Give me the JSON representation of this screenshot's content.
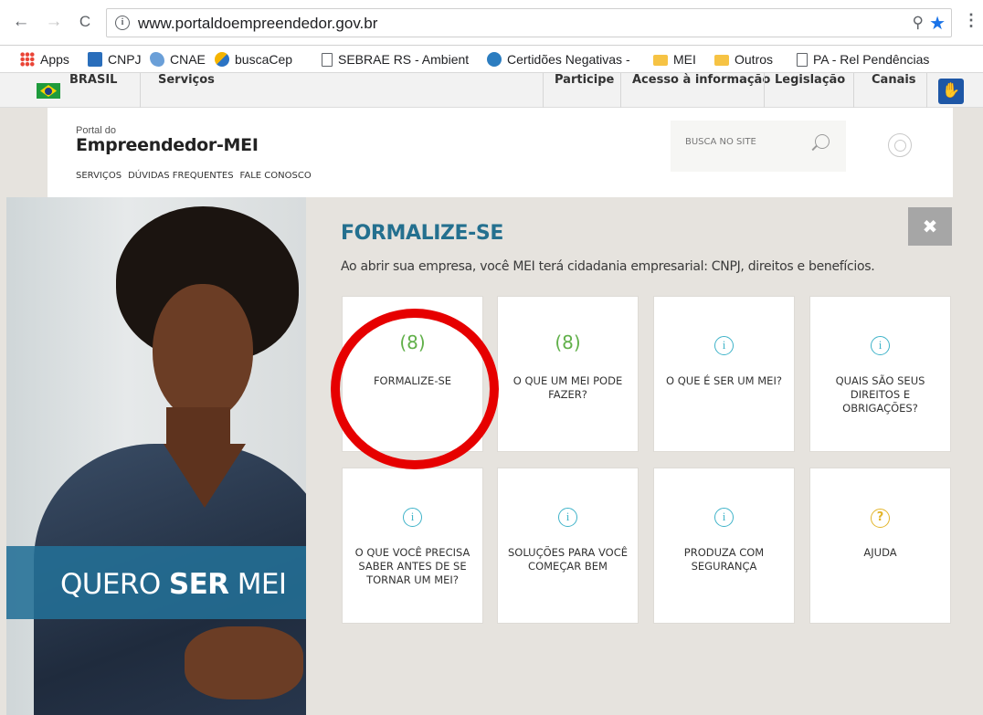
{
  "browser": {
    "url": "www.portaldoempreendedor.gov.br",
    "nav": {
      "back": "←",
      "forward": "→",
      "reload": "C"
    },
    "bookmarks": [
      {
        "label": "Apps",
        "icon": "apps-grid-icon"
      },
      {
        "label": "CNPJ",
        "icon": "cnpj-favicon"
      },
      {
        "label": "CNAE",
        "icon": "cnae-favicon"
      },
      {
        "label": "buscaCep",
        "icon": "buscacep-favicon"
      },
      {
        "label": "SEBRAE RS - Ambient",
        "icon": "page-icon"
      },
      {
        "label": "Certidões Negativas -",
        "icon": "certidoes-favicon"
      },
      {
        "label": "MEI",
        "icon": "folder-icon"
      },
      {
        "label": "Outros",
        "icon": "folder-icon"
      },
      {
        "label": "PA - Rel Pendências",
        "icon": "page-icon"
      }
    ]
  },
  "gov_bar": {
    "brasil": "BRASIL",
    "servicos": "Serviços",
    "links": [
      "Participe",
      "Acesso à informação",
      "Legislação",
      "Canais"
    ]
  },
  "portal": {
    "small_title": "Portal do",
    "title": "Empreendedor-MEI",
    "nav": [
      "SERVIÇOS",
      "DÚVIDAS FREQUENTES",
      "FALE CONOSCO"
    ],
    "search_placeholder": "BUSCA NO SITE"
  },
  "hero": {
    "banner_prefix": "QUERO ",
    "banner_bold": "SER",
    "banner_suffix": " MEI"
  },
  "section": {
    "title": "FORMALIZE-SE",
    "subtitle": "Ao abrir sua empresa, você MEI terá cidadania empresarial: CNPJ, direitos e benefícios.",
    "close": "✖"
  },
  "tiles": [
    {
      "label": "FORMALIZE-SE",
      "icon": "people-icon",
      "glyph": "(8)"
    },
    {
      "label": "O QUE UM MEI PODE FAZER?",
      "icon": "people-icon",
      "glyph": "(8)"
    },
    {
      "label": "O QUE É SER UM MEI?",
      "icon": "info-icon",
      "glyph": "i"
    },
    {
      "label": "QUAIS SÃO SEUS DIREITOS E OBRIGAÇÕES?",
      "icon": "info-icon",
      "glyph": "i"
    },
    {
      "label": "O QUE VOCÊ PRECISA SABER ANTES DE SE TORNAR UM MEI?",
      "icon": "info-icon",
      "glyph": "i"
    },
    {
      "label": "SOLUÇÕES PARA VOCÊ COMEÇAR BEM",
      "icon": "info-icon",
      "glyph": "i"
    },
    {
      "label": "PRODUZA COM SEGURANÇA",
      "icon": "info-icon",
      "glyph": "i"
    },
    {
      "label": "AJUDA",
      "icon": "help-icon",
      "glyph": "?"
    }
  ],
  "colors": {
    "accent": "#24708f",
    "annotation_circle": "#e60000",
    "info_icon": "#3fb3c9",
    "people_icon": "#61b04a",
    "help_icon": "#e3b52a"
  }
}
